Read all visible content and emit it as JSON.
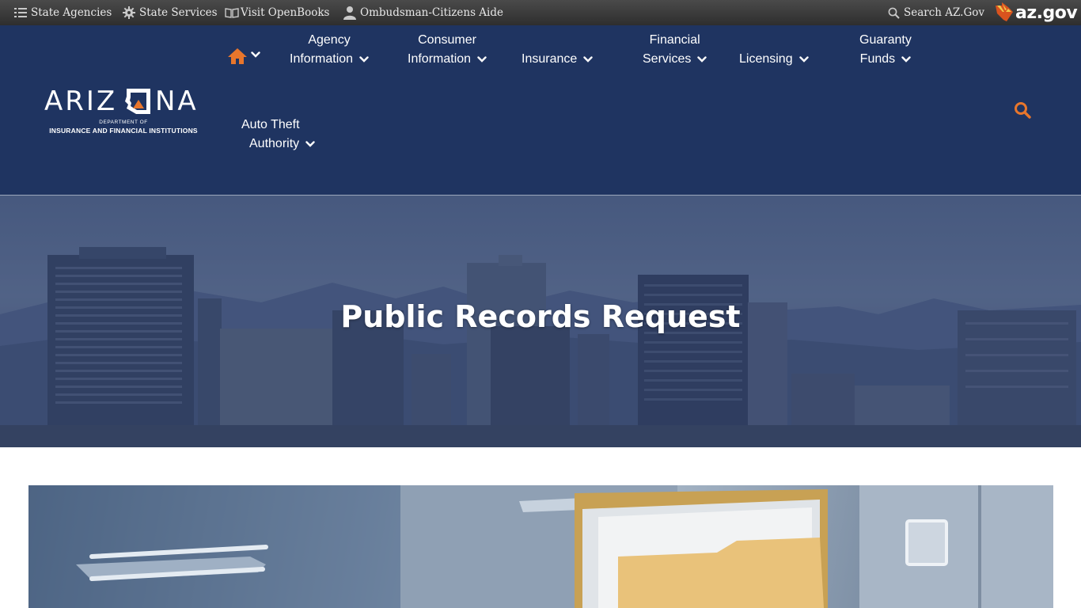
{
  "topbar": {
    "state_agencies": "State Agencies",
    "state_services": "State Services",
    "visit_openbooks": "Visit OpenBooks",
    "ombudsman": "Ombudsman-Citizens Aide",
    "search_azgov": "Search AZ.Gov",
    "azgov_logo": "az.gov"
  },
  "logo": {
    "word_left": "ARIZ",
    "word_right": "NA",
    "badge": "DIFI",
    "line1": "DEPARTMENT OF",
    "line2": "INSURANCE AND FINANCIAL INSTITUTIONS"
  },
  "nav": {
    "home_icon": "home-icon",
    "agency_information": [
      "Agency",
      "Information"
    ],
    "consumer_information": [
      "Consumer",
      "Information"
    ],
    "insurance": "Insurance",
    "financial_services": [
      "Financial",
      "Services"
    ],
    "licensing": "Licensing",
    "guaranty_funds": [
      "Guaranty",
      "Funds"
    ],
    "auto_theft_authority": [
      "Auto Theft",
      "Authority"
    ],
    "search_icon": "search-icon"
  },
  "hero": {
    "title": "Public Records Request"
  },
  "colors": {
    "topbar": "#2e2e2e",
    "header": "#1f3461",
    "accent": "#e8762c",
    "text_light": "#ffffff"
  }
}
